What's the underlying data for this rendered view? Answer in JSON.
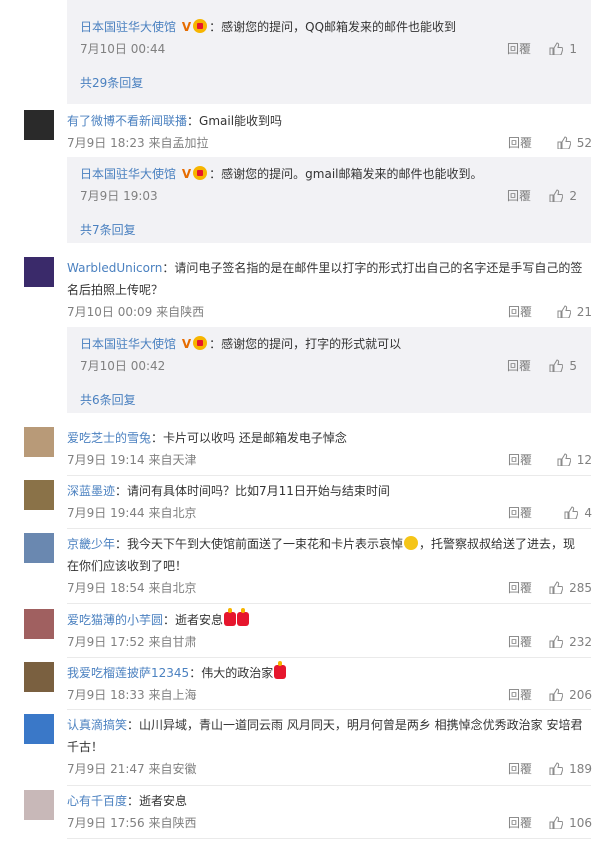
{
  "ui": {
    "reply_label": "回覆",
    "colon": "："
  },
  "top_sub": {
    "user": "日本国驻华大使馆",
    "text": "感谢您的提问，QQ邮箱发来的邮件也能收到",
    "time": "7月10日 00:44",
    "likes": "1",
    "more": "共29条回复"
  },
  "comments": [
    {
      "user": "有了微博不看新闻联播",
      "text": "Gmail能收到吗",
      "time": "7月9日 18:23 来自孟加拉",
      "likes": "52",
      "avatar_color": "#222222",
      "sub": {
        "user": "日本国驻华大使馆",
        "text": "感谢您的提问。gmail邮箱发来的邮件也能收到。",
        "time": "7月9日 19:03",
        "likes": "2",
        "more": "共7条回复"
      }
    },
    {
      "user": "WarbledUnicorn",
      "text_line1": "请问电子签名指的是在邮件里以打字的形式打出自己的名字还是手写自己的签",
      "text_line2": "名后拍照上传呢？",
      "time": "7月10日 00:09 来自陕西",
      "likes": "21",
      "avatar_color": "#3a2a6a",
      "sub": {
        "user": "日本国驻华大使馆",
        "text": "感谢您的提问，打字的形式就可以",
        "time": "7月10日 00:42",
        "likes": "5",
        "more": "共6条回复"
      }
    },
    {
      "user": "爱吃芝士的雪兔",
      "text": "卡片可以收吗 还是邮箱发电子悼念",
      "time": "7月9日 19:14 来自天津",
      "likes": "12",
      "avatar_color": "#b89a78"
    },
    {
      "user": "深蓝墨迹",
      "text": "请问有具体时间吗？比如7月11日开始与结束时间",
      "time": "7月9日 19:44 来自北京",
      "likes": "4",
      "avatar_color": "#8a7248"
    },
    {
      "user": "京畿少年",
      "text_line1a": "我今天下午到大使馆前面送了一束花和卡片表示哀悼",
      "text_line1b": "，托警察叔叔给送了进去，现",
      "text_line2": "在你们应该收到了吧！",
      "time": "7月9日 18:54 来自北京",
      "likes": "285",
      "avatar_color": "#6a88b0"
    },
    {
      "user": "爱吃猫薄的小芋圆",
      "text": "逝者安息",
      "time": "7月9日 17:52 来自甘肃",
      "likes": "232",
      "avatar_color": "#a06060"
    },
    {
      "user": "我爱吃榴莲披萨12345",
      "text": "伟大的政治家",
      "time": "7月9日 18:33 来自上海",
      "likes": "206",
      "avatar_color": "#7a6040"
    },
    {
      "user": "认真滴搞笑",
      "text_line1": "山川异域，青山一道同云雨 风月同天，明月何曾是两乡 相携悼念优秀政治家 安培君",
      "text_line2": "千古！",
      "time": "7月9日 21:47 来自安徽",
      "likes": "189",
      "avatar_color": "#3a78c8"
    },
    {
      "user": "心有千百度",
      "text": "逝者安息",
      "time": "7月9日 17:56 来自陕西",
      "likes": "106",
      "avatar_color": "#c8b8b8"
    }
  ]
}
